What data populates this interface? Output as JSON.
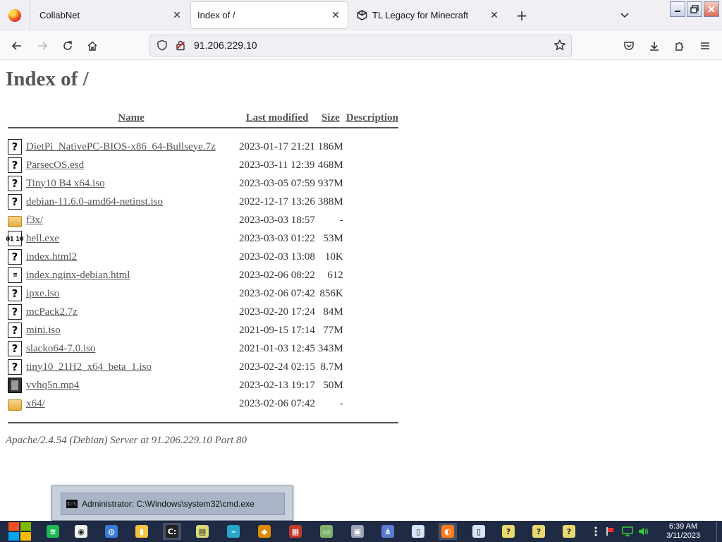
{
  "browser": {
    "tabs": [
      {
        "title": "CollabNet",
        "active": false
      },
      {
        "title": "Index of /",
        "active": true
      },
      {
        "title": "TL Legacy for Minecraft",
        "active": false
      }
    ],
    "url": "91.206.229.10",
    "close_glyph": "✕",
    "new_tab_glyph": "+",
    "tab_list_glyph": "⌄",
    "icons": {
      "back": "back-arrow-icon",
      "forward": "forward-arrow-icon",
      "reload": "reload-icon",
      "home": "home-icon",
      "shield": "tracking-shield-icon",
      "lock": "insecure-lock-icon",
      "bookmark": "star-icon",
      "pocket": "pocket-icon",
      "downloads": "download-icon",
      "extensions": "extensions-icon",
      "menu": "hamburger-menu-icon"
    }
  },
  "page": {
    "heading": "Index of /",
    "columns": {
      "name": "Name",
      "last_modified": "Last modified",
      "size": "Size",
      "description": "Description"
    },
    "files": [
      {
        "name": "DietPi_NativePC-BIOS-x86_64-Bullseye.7z",
        "modified": "2023-01-17 21:21",
        "size": "186M",
        "icon": "unknown"
      },
      {
        "name": "ParsecOS.esd",
        "modified": "2023-03-11 12:39",
        "size": "468M",
        "icon": "unknown"
      },
      {
        "name": "Tiny10 B4 x64.iso",
        "modified": "2023-03-05 07:59",
        "size": "937M",
        "icon": "unknown"
      },
      {
        "name": "debian-11.6.0-amd64-netinst.iso",
        "modified": "2022-12-17 13:26",
        "size": "388M",
        "icon": "unknown"
      },
      {
        "name": "f3x/",
        "modified": "2023-03-03 18:57",
        "size": "-",
        "icon": "folder"
      },
      {
        "name": "hell.exe",
        "modified": "2023-03-03 01:22",
        "size": "53M",
        "icon": "binary"
      },
      {
        "name": "index.html2",
        "modified": "2023-02-03 13:08",
        "size": "10K",
        "icon": "unknown"
      },
      {
        "name": "index.nginx-debian.html",
        "modified": "2023-02-06 08:22",
        "size": "612",
        "icon": "text"
      },
      {
        "name": "ipxe.iso",
        "modified": "2023-02-06 07:42",
        "size": "856K",
        "icon": "unknown"
      },
      {
        "name": "mcPack2.7z",
        "modified": "2023-02-20 17:24",
        "size": "84M",
        "icon": "unknown"
      },
      {
        "name": "mini.iso",
        "modified": "2021-09-15 17:14",
        "size": "77M",
        "icon": "unknown"
      },
      {
        "name": "slacko64-7.0.iso",
        "modified": "2021-01-03 12:45",
        "size": "343M",
        "icon": "unknown"
      },
      {
        "name": "tiny10_21H2_x64_beta_1.iso",
        "modified": "2023-02-24 02:15",
        "size": "8.7M",
        "icon": "unknown"
      },
      {
        "name": "vvhq5n.mp4",
        "modified": "2023-02-13 19:17",
        "size": "50M",
        "icon": "movie"
      },
      {
        "name": "x64/",
        "modified": "2023-02-06 07:42",
        "size": "-",
        "icon": "folder"
      }
    ],
    "server_signature": "Apache/2.4.54 (Debian) Server at 91.206.229.10 Port 80"
  },
  "taskbar": {
    "preview_title": "Administrator: C:\\Windows\\system32\\cmd.exe",
    "clock_time": "6:39 AM",
    "clock_date": "3/11/2023",
    "apps": [
      "spotify-icon",
      "chrome-icon",
      "network-globe-icon",
      "file-explorer-icon",
      "cmd-icon",
      "notepad-icon",
      "app-icon",
      "avast-icon",
      "app-icon",
      "monitor-icon",
      "printer-icon",
      "network-icon",
      "document-icon",
      "firefox-icon",
      "document-icon",
      "notepad-help-icon",
      "notepad-help-icon",
      "notepad-help-icon"
    ],
    "colors": {
      "bar": "#1f2a44",
      "accent": "#00a4ef"
    }
  }
}
